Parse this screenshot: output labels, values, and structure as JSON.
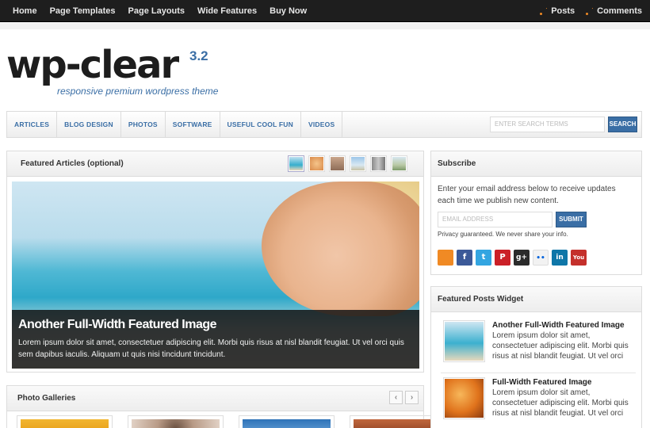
{
  "topnav": {
    "items": [
      "Home",
      "Page Templates",
      "Page Layouts",
      "Wide Features",
      "Buy Now"
    ],
    "feeds": [
      "Posts",
      "Comments"
    ]
  },
  "logo": {
    "name": "wp-clear",
    "version": "3.2",
    "tagline": "responsive premium wordpress theme"
  },
  "catnav": {
    "items": [
      "ARTICLES",
      "BLOG DESIGN",
      "PHOTOS",
      "SOFTWARE",
      "USEFUL COOL FUN",
      "VIDEOS"
    ],
    "search_placeholder": "ENTER SEARCH TERMS",
    "search_button": "SEARCH"
  },
  "featured": {
    "title": "Featured Articles (optional)",
    "slide_title": "Another Full-Width Featured Image",
    "slide_text": "Lorem ipsum dolor sit amet, consectetuer adipiscing elit. Morbi quis risus at nisl blandit feugiat. Ut vel orci quis sem dapibus iaculis. Aliquam ut quis nisi tincidunt tincidunt."
  },
  "galleries": {
    "title": "Photo Galleries",
    "prev": "‹",
    "next": "›"
  },
  "subscribe": {
    "title": "Subscribe",
    "text": "Enter your email address below to receive updates each time we publish new content.",
    "email_placeholder": "EMAIL ADDRESS",
    "submit": "SUBMIT",
    "privacy": "Privacy guaranteed. We never share your info.",
    "social": [
      {
        "icon": "rss-icon",
        "glyph": "",
        "color": "#f08a24"
      },
      {
        "icon": "facebook-icon",
        "glyph": "f",
        "color": "#3b5998"
      },
      {
        "icon": "twitter-icon",
        "glyph": "t",
        "color": "#33a5e1"
      },
      {
        "icon": "pinterest-icon",
        "glyph": "P",
        "color": "#cb2027"
      },
      {
        "icon": "googleplus-icon",
        "glyph": "g+",
        "color": "#2b2b2b"
      },
      {
        "icon": "flickr-icon",
        "glyph": "••",
        "color": "#f2f2f2"
      },
      {
        "icon": "linkedin-icon",
        "glyph": "in",
        "color": "#0e76a8"
      },
      {
        "icon": "youtube-icon",
        "glyph": "You",
        "color": "#c4302b"
      }
    ]
  },
  "featured_posts": {
    "title": "Featured Posts Widget",
    "items": [
      {
        "title": "Another Full-Width Featured Image",
        "text": "Lorem ipsum dolor sit amet, consectetuer adipiscing elit. Morbi quis risus at nisl blandit feugiat. Ut vel orci"
      },
      {
        "title": "Full-Width Featured Image",
        "text": "Lorem ipsum dolor sit amet, consectetuer adipiscing elit. Morbi quis risus at nisl blandit feugiat. Ut vel orci"
      }
    ]
  }
}
